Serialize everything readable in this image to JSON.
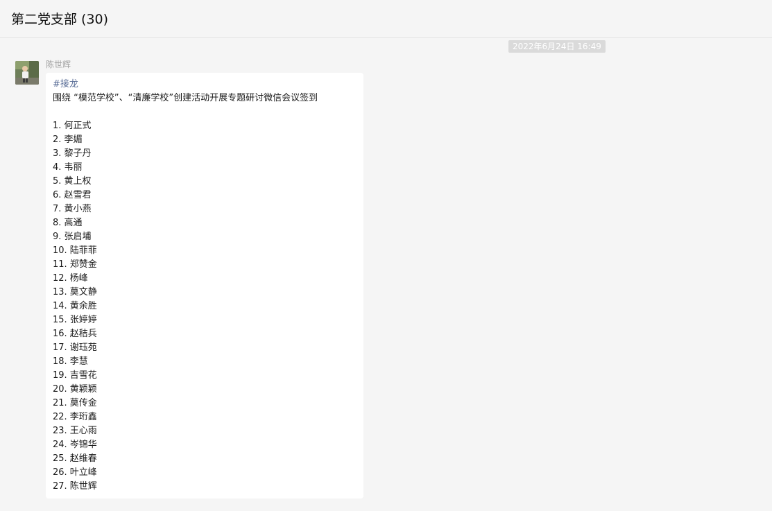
{
  "header": {
    "title": "第二党支部 (30)"
  },
  "message": {
    "timestamp": "2022年6月24日 16:49",
    "sender": "陈世辉",
    "avatar_icon": "user-photo-avatar",
    "hashtag": "#接龙",
    "subject": "围绕 “模范学校”、“清廉学校”创建活动开展专题研讨微信会议签到",
    "entries": [
      "1. 何正式",
      "2. 李媚",
      "3. 黎子丹",
      "4. 韦丽",
      "5. 黄上权",
      "6. 赵雪君",
      "7. 黄小燕",
      "8. 高通",
      "9. 张启埔",
      "10. 陆菲菲",
      "11. 郑赞金",
      "12. 杨峰",
      "13. 莫文静",
      "14. 黄余胜",
      "15. 张婷婷",
      "16. 赵秸兵",
      "17. 谢珏苑",
      "18. 李慧",
      "19. 吉雪花",
      "20. 黄颖颖",
      "21. 莫传金",
      "22. 李珩鑫",
      "23. 王心雨",
      "24. 岑锦华",
      "25. 赵维春",
      "26. 叶立峰",
      "27. 陈世辉"
    ]
  }
}
